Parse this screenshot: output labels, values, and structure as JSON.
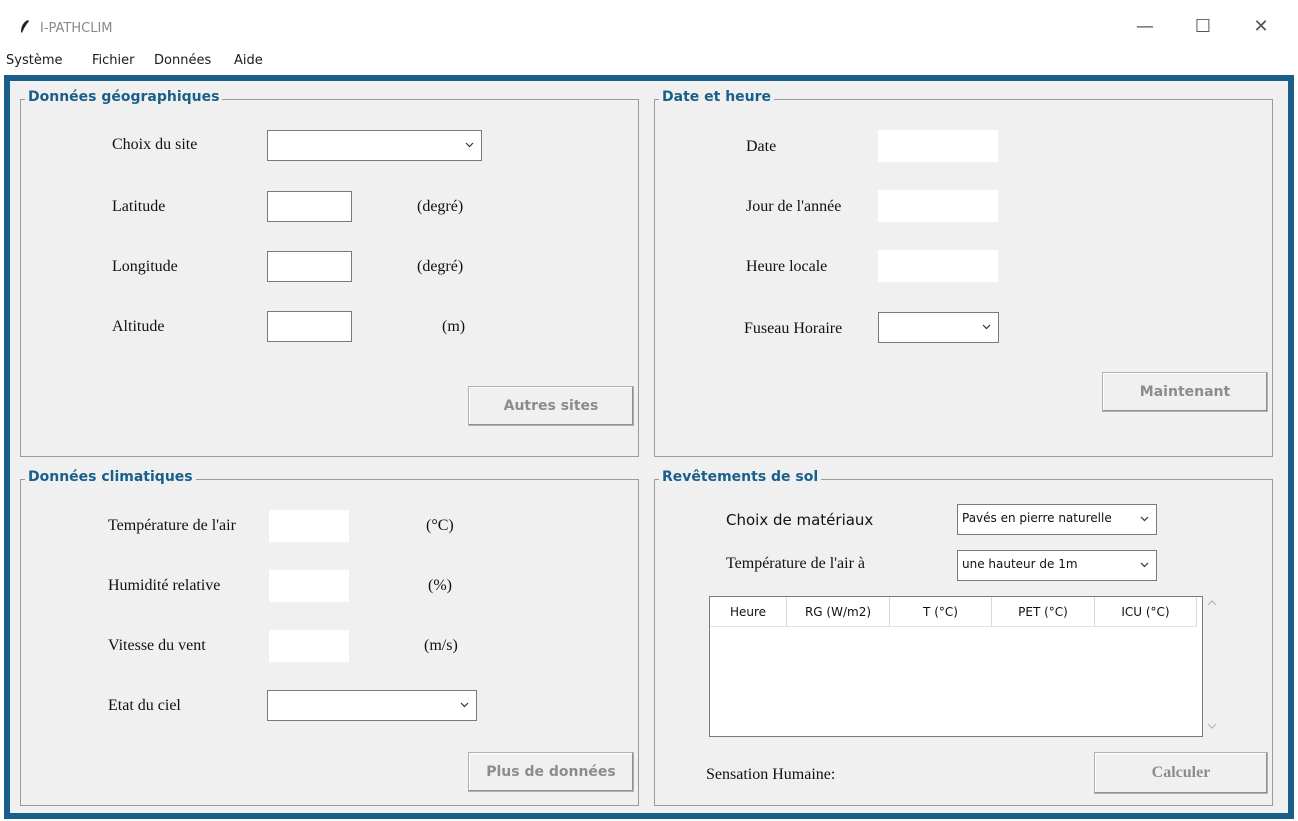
{
  "window": {
    "title": "I-PATHCLIM",
    "minimize": "—",
    "maximize": "☐",
    "close": "✕"
  },
  "menu": [
    "Système",
    "Fichier",
    "Données",
    "Aide"
  ],
  "geo": {
    "title": "Données géographiques",
    "site_label": "Choix du site",
    "site_value": "",
    "latitude_label": "Latitude",
    "latitude_unit": "(degré)",
    "latitude_value": "",
    "longitude_label": "Longitude",
    "longitude_unit": "(degré)",
    "longitude_value": "",
    "altitude_label": "Altitude",
    "altitude_unit": "(m)",
    "altitude_value": "",
    "button": "Autres sites"
  },
  "date": {
    "title": "Date et heure",
    "date_label": "Date",
    "date_value": "",
    "day_label": "Jour de l'année",
    "day_value": "",
    "hour_label": "Heure locale",
    "hour_value": "",
    "tz_label": "Fuseau Horaire",
    "tz_value": "",
    "button": "Maintenant"
  },
  "climate": {
    "title": "Données climatiques",
    "temp_label": "Température de l'air",
    "temp_unit": "(°C)",
    "temp_value": "",
    "humidity_label": "Humidité relative",
    "humidity_unit": "(%)",
    "humidity_value": "",
    "wind_label": "Vitesse du vent",
    "wind_unit": "(m/s)",
    "wind_value": "",
    "sky_label": "Etat du ciel",
    "sky_value": "",
    "button": "Plus de données"
  },
  "ground": {
    "title": "Revêtements de sol",
    "material_label": "Choix de matériaux",
    "material_value": "Pavés en pierre naturelle",
    "height_label": "Température de l'air à",
    "height_value": "une hauteur de 1m",
    "columns": [
      "Heure",
      "RG (W/m2)",
      "T (°C)",
      "PET (°C)",
      "ICU (°C)"
    ],
    "sensation_label": "Sensation Humaine:",
    "button": "Calculer"
  },
  "colors": {
    "accent": "#1a5e8a",
    "panel_bg": "#f0f0f0",
    "disabled_text": "#8c8c8c"
  }
}
